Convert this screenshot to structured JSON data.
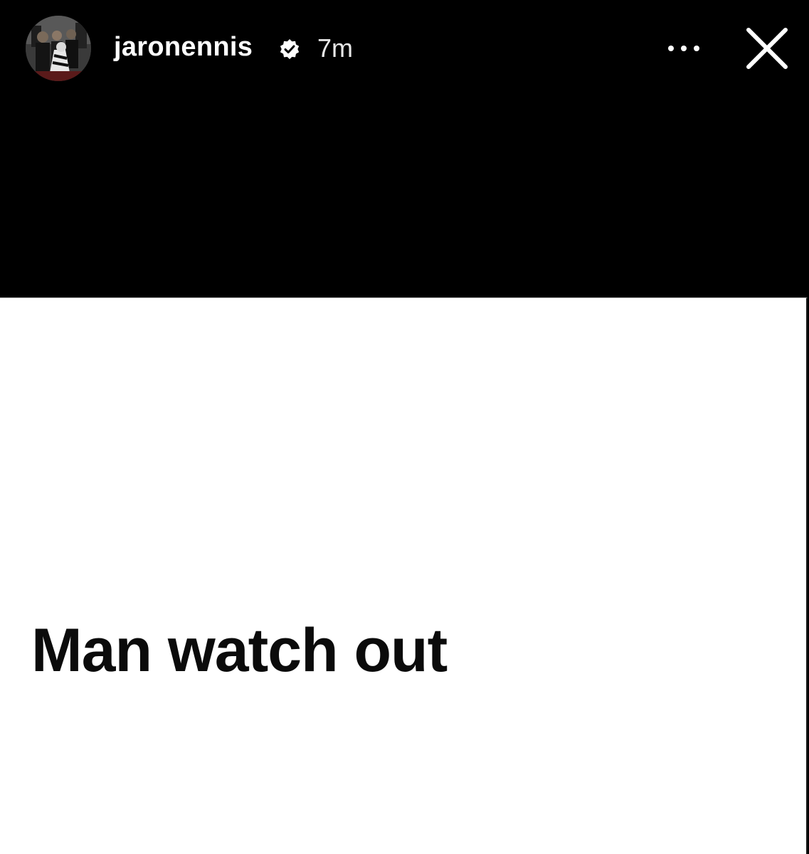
{
  "story": {
    "username": "jaronennis",
    "time_ago": "7m",
    "verified": true,
    "post_text": "Man watch out"
  },
  "icons": {
    "verified": "verified-badge-icon",
    "more": "more-horizontal-icon",
    "close": "close-icon"
  },
  "colors": {
    "header_background": "#000000",
    "card_background": "#ffffff",
    "text_primary": "#0b0b0b",
    "header_text": "#ffffff"
  }
}
